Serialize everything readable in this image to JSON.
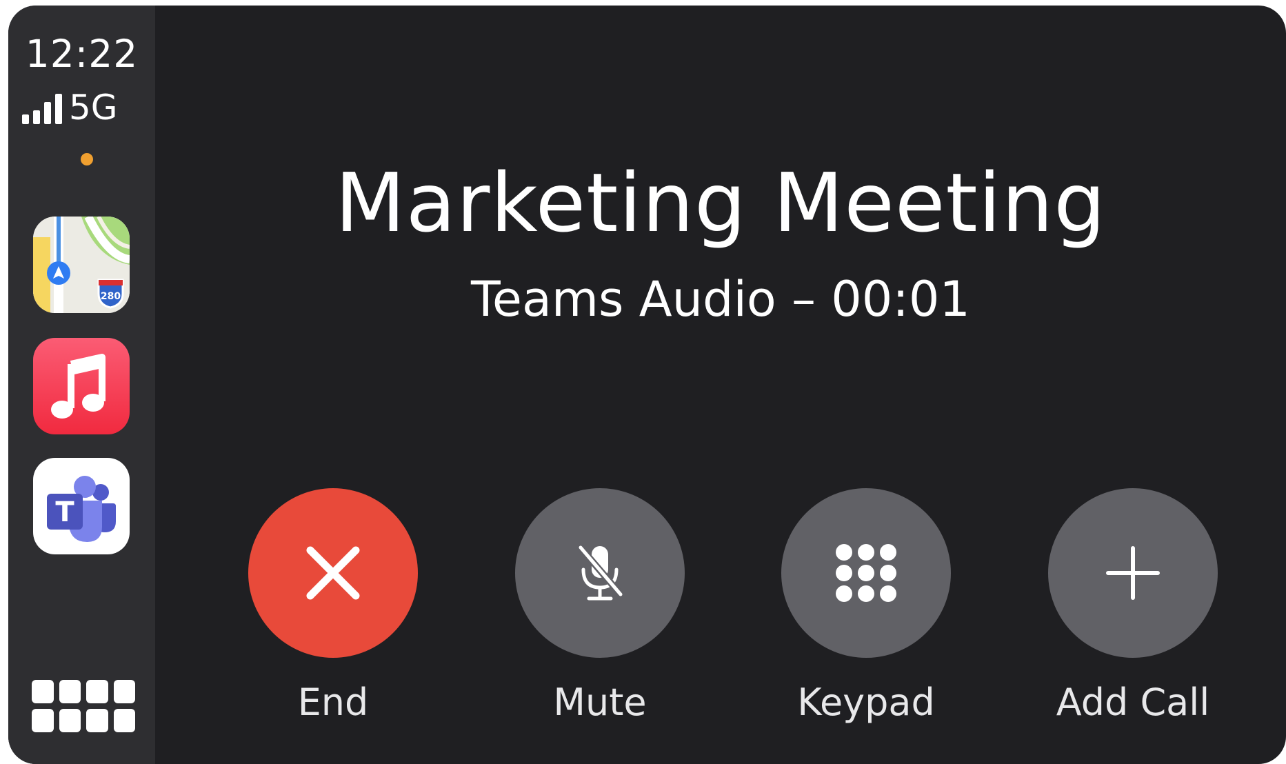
{
  "status_bar": {
    "time": "12:22",
    "network": "5G",
    "signal_bars": 4,
    "mic_indicator_color": "#f0a030"
  },
  "dock": {
    "apps": [
      {
        "name": "maps-icon"
      },
      {
        "name": "music-icon"
      },
      {
        "name": "teams-icon"
      }
    ],
    "maps_shield_text": "280",
    "teams_letter": "T",
    "app_grid_icon": "app-grid-icon"
  },
  "call": {
    "title": "Marketing Meeting",
    "subtitle": "Teams Audio – 00:01"
  },
  "controls": [
    {
      "label": "End",
      "icon": "close-icon",
      "color": "#e84a3a"
    },
    {
      "label": "Mute",
      "icon": "mic-muted-icon",
      "color": "#616166"
    },
    {
      "label": "Keypad",
      "icon": "keypad-icon",
      "color": "#616166"
    },
    {
      "label": "Add Call",
      "icon": "plus-icon",
      "color": "#616166"
    }
  ]
}
